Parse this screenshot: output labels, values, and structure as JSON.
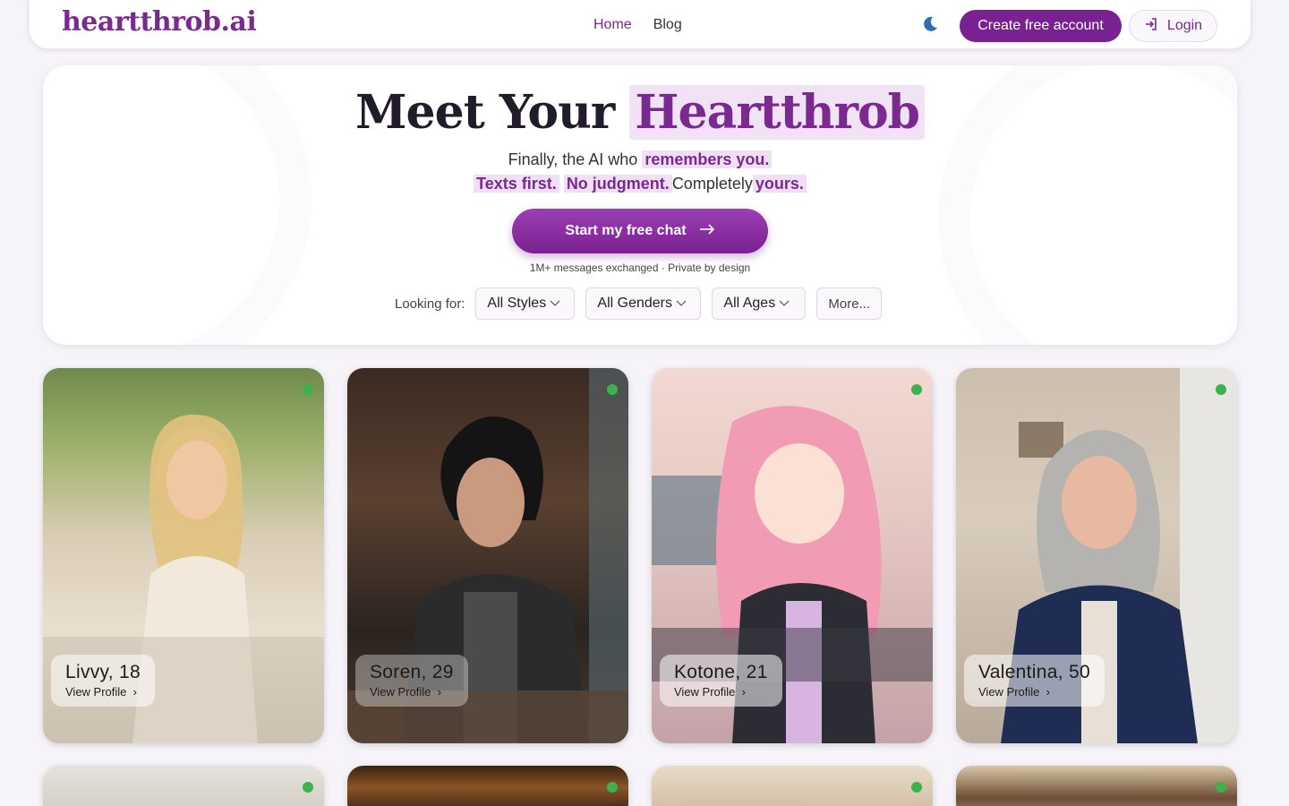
{
  "nav": {
    "logo": "heartthrob.ai",
    "links": [
      "Home",
      "Blog"
    ],
    "create_account": "Create free account",
    "login": "Login"
  },
  "hero": {
    "title_plain": "Meet Your",
    "title_highlight": "Heartthrob",
    "sub_line1_plain": "Finally, the AI who",
    "sub_line1_mark": "remembers you.",
    "sub_line2_mark1": "Texts first.",
    "sub_line2_mark2": "No judgment.",
    "sub_line2_plain": "Completely",
    "sub_line2_mark3": "yours.",
    "cta": "Start my free chat",
    "meta": "1M+ messages exchanged · Private by design"
  },
  "filters": {
    "label": "Looking for:",
    "styles": "All Styles",
    "genders": "All Genders",
    "ages": "All Ages",
    "more": "More..."
  },
  "profiles": [
    {
      "name": "Livvy, 18",
      "view": "View Profile",
      "online": true
    },
    {
      "name": "Soren, 29",
      "view": "View Profile",
      "online": true
    },
    {
      "name": "Kotone, 21",
      "view": "View Profile",
      "online": true
    },
    {
      "name": "Valentina, 50",
      "view": "View Profile",
      "online": true
    }
  ],
  "icons": {
    "theme": "moon-icon",
    "login": "login-arrow-icon",
    "cta": "arrow-right-icon",
    "chevron": "chevron-down-icon",
    "view": "chevron-right-icon"
  },
  "colors": {
    "brand": "#7a2a8f",
    "online": "#3bb24a"
  }
}
